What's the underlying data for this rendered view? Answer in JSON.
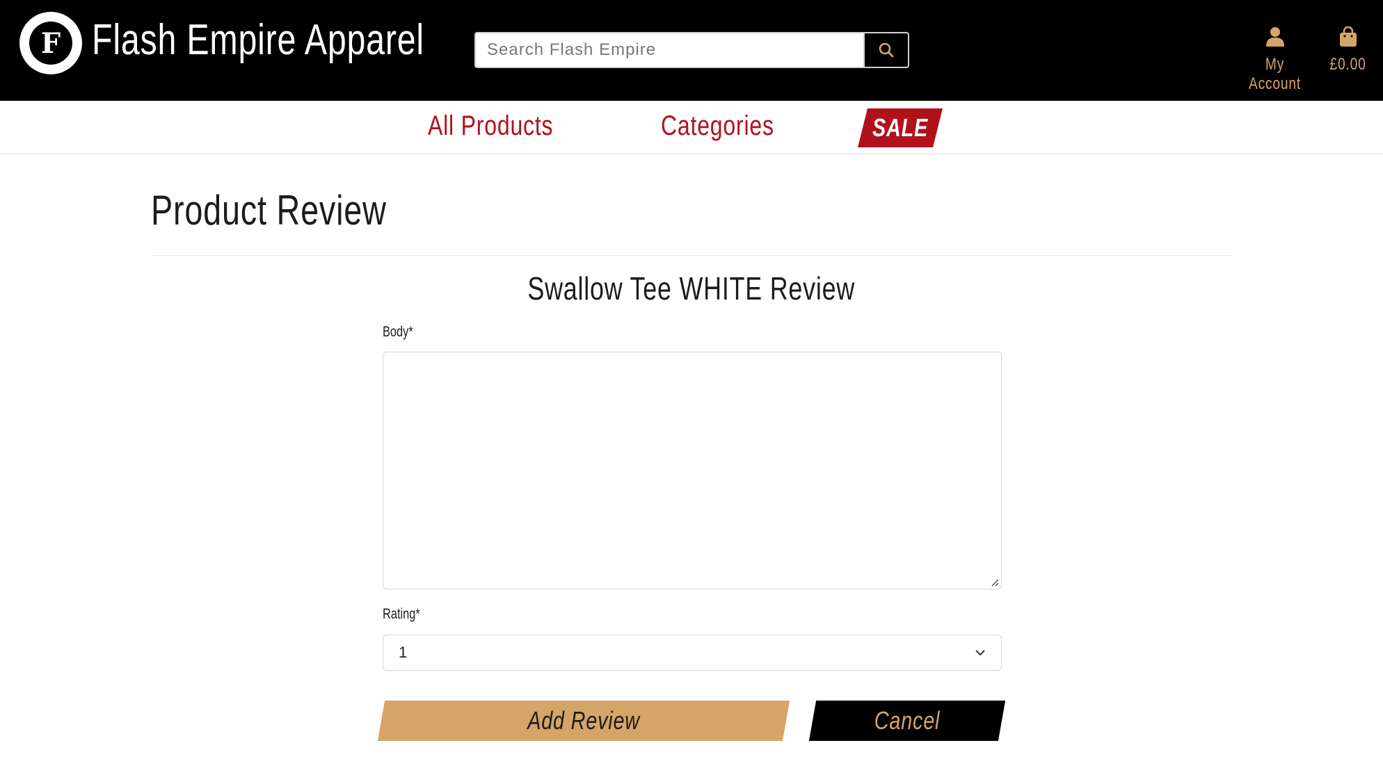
{
  "header": {
    "brand_title": "Flash Empire Apparel",
    "logo_letter": "F",
    "search_placeholder": "Search Flash Empire",
    "account_label": "My Account",
    "cart_total": "£0.00",
    "accent_color": "#d4a566"
  },
  "nav": {
    "all_products": "All Products",
    "categories": "Categories",
    "sale": "SALE",
    "accent_color": "#b0111b"
  },
  "main": {
    "page_title": "Product Review",
    "product_heading": "Swallow Tee WHITE Review",
    "body_label": "Body*",
    "body_value": "",
    "rating_label": "Rating*",
    "rating_value": "1",
    "add_button": "Add Review",
    "cancel_button": "Cancel"
  },
  "icons": {
    "search": "search-icon",
    "account": "user-icon",
    "cart": "shopping-bag-icon",
    "select": "chevron-down-icon"
  }
}
